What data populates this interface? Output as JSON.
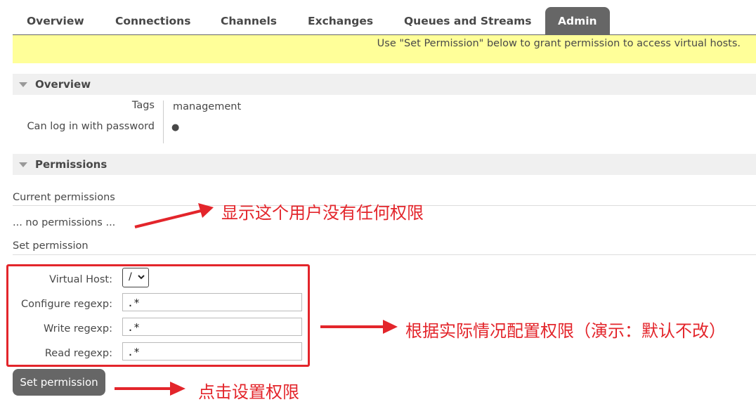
{
  "nav": {
    "tabs": [
      "Overview",
      "Connections",
      "Channels",
      "Exchanges",
      "Queues and Streams",
      "Admin"
    ],
    "active": "Admin"
  },
  "banner": {
    "text": "Use \"Set Permission\" below to grant permission to access virtual hosts."
  },
  "overview": {
    "title": "Overview",
    "tags_label": "Tags",
    "tags_value": "management",
    "login_label": "Can log in with password",
    "login_value": "●"
  },
  "permissions": {
    "title": "Permissions",
    "current_label": "Current permissions",
    "no_permissions": "... no permissions ...",
    "set_label": "Set permission",
    "vhost_label": "Virtual Host:",
    "vhost_value": "/",
    "configure_label": "Configure regexp:",
    "configure_value": ".*",
    "write_label": "Write regexp:",
    "write_value": ".*",
    "read_label": "Read regexp:",
    "read_value": ".*",
    "button": "Set permission"
  },
  "annotations": {
    "note1": "显示这个用户没有任何权限",
    "note2": "根据实际情况配置权限（演示：默认不改）",
    "note3": "点击设置权限",
    "color": "#e3252b"
  }
}
